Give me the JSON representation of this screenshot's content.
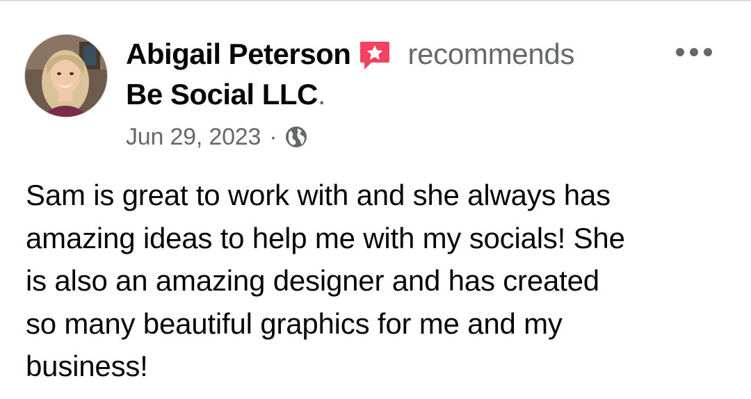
{
  "post": {
    "author": "Abigail Peterson",
    "action": "recommends",
    "page": "Be Social LLC",
    "period": ".",
    "date": "Jun 29, 2023",
    "separator": "·",
    "privacy_icon": "globe-icon",
    "recommend_icon": "recommendation-star-icon",
    "more_icon": "more-options-icon",
    "body_lines": [
      "Sam is great to work with and she always has",
      "amazing ideas to help me with my socials! She",
      "is also an amazing designer and has created",
      "so many beautiful graphics for me and my",
      "business!"
    ]
  },
  "colors": {
    "primary_text": "#050505",
    "secondary_text": "#65676b",
    "recommend_icon": "#f3425f",
    "background": "#ffffff",
    "divider": "#dadde1"
  }
}
